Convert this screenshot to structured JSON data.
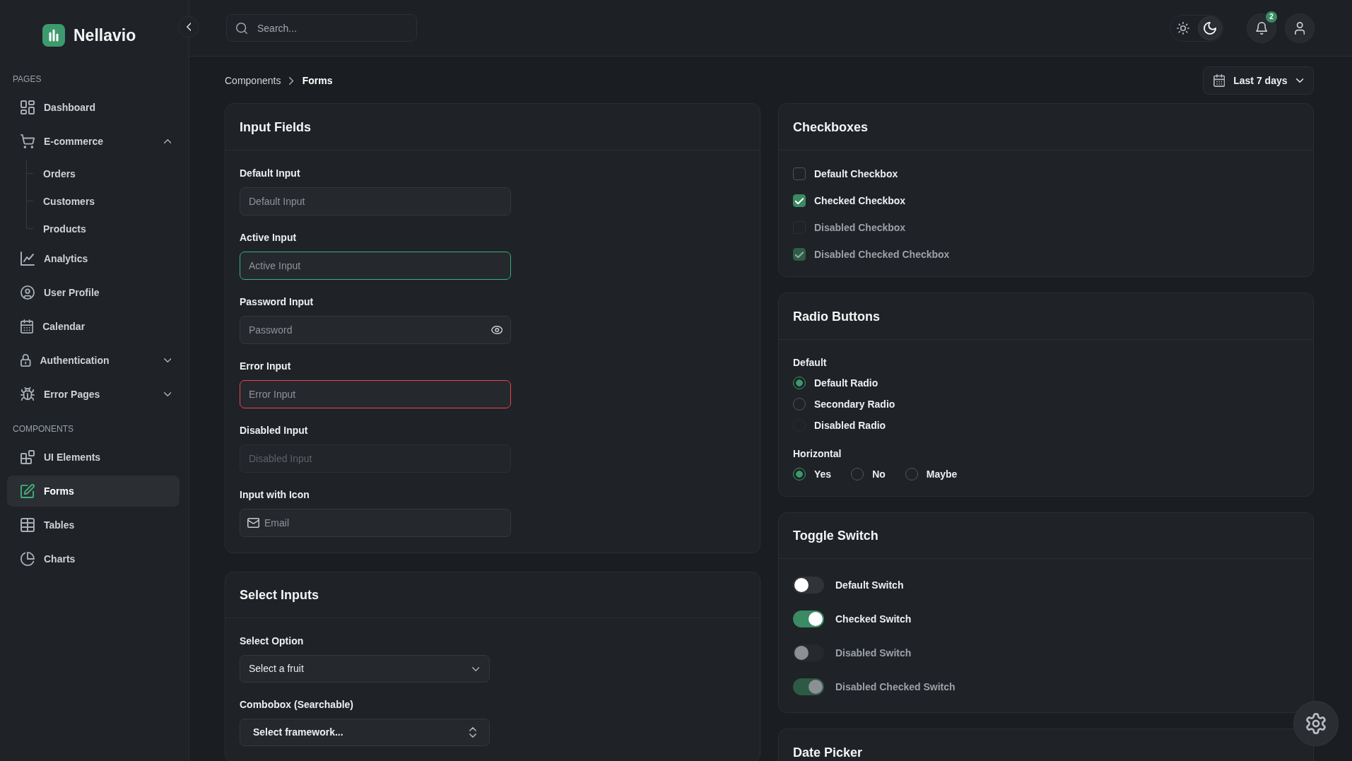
{
  "sidebar": {
    "brand": "Nellavio",
    "sections": [
      {
        "heading": "PAGES",
        "items": [
          {
            "label": "Dashboard",
            "selected": false
          },
          {
            "label": "E-commerce",
            "selected": false,
            "expanded": true,
            "children": [
              {
                "label": "Orders",
                "selected": false
              },
              {
                "label": "Customers",
                "selected": false
              },
              {
                "label": "Products",
                "selected": false
              }
            ]
          },
          {
            "label": "Analytics",
            "selected": false
          },
          {
            "label": "User Profile",
            "selected": false
          },
          {
            "label": "Calendar",
            "selected": false
          },
          {
            "label": "Authentication",
            "selected": false,
            "expanded": false
          },
          {
            "label": "Error Pages",
            "selected": false,
            "expanded": false
          }
        ]
      },
      {
        "heading": "COMPONENTS",
        "items": [
          {
            "label": "UI Elements",
            "selected": false
          },
          {
            "label": "Forms",
            "selected": true
          },
          {
            "label": "Tables",
            "selected": false
          },
          {
            "label": "Charts",
            "selected": false
          }
        ]
      }
    ]
  },
  "topbar": {
    "search": {
      "placeholder": "Search..."
    },
    "theme_options": [
      {
        "selected": false
      },
      {
        "selected": true
      }
    ],
    "notifications": {
      "count": "2"
    }
  },
  "breadcrumb": [
    {
      "label": "Components",
      "current": false
    },
    {
      "label": "Forms",
      "current": true
    }
  ],
  "date_range": {
    "label": "Last 7 days"
  },
  "input_fields": {
    "title": "Input Fields",
    "fields": [
      {
        "label": "Default Input",
        "placeholder": "Default Input",
        "kind": "text",
        "active": false,
        "error": false,
        "disabled": false
      },
      {
        "label": "Active Input",
        "placeholder": "Active Input",
        "kind": "text",
        "active": true,
        "error": false,
        "disabled": false
      },
      {
        "label": "Password Input",
        "placeholder": "Password",
        "kind": "password",
        "active": false,
        "error": false,
        "disabled": false
      },
      {
        "label": "Error Input",
        "placeholder": "Error Input",
        "kind": "text",
        "active": false,
        "error": true,
        "disabled": false
      },
      {
        "label": "Disabled Input",
        "placeholder": "Disabled Input",
        "kind": "text",
        "active": false,
        "error": false,
        "disabled": true
      },
      {
        "label": "Input with Icon",
        "placeholder": "Email",
        "kind": "email",
        "active": false,
        "error": false,
        "disabled": false
      }
    ]
  },
  "select_inputs": {
    "title": "Select Inputs",
    "fields": [
      {
        "label": "Select Option",
        "value": "Select a fruit",
        "kind": "select"
      },
      {
        "label": "Combobox (Searchable)",
        "value": "Select framework...",
        "kind": "combobox"
      }
    ]
  },
  "checkboxes": {
    "title": "Checkboxes",
    "items": [
      {
        "label": "Default Checkbox",
        "checked": false,
        "disabled": false
      },
      {
        "label": "Checked Checkbox",
        "checked": true,
        "disabled": false
      },
      {
        "label": "Disabled Checkbox",
        "checked": false,
        "disabled": true
      },
      {
        "label": "Disabled Checked Checkbox",
        "checked": true,
        "disabled": true
      }
    ]
  },
  "radio_buttons": {
    "title": "Radio Buttons",
    "groups": [
      {
        "label": "Default",
        "kind": "vertical",
        "options": [
          {
            "label": "Default Radio",
            "selected": true,
            "disabled": false
          },
          {
            "label": "Secondary Radio",
            "selected": false,
            "disabled": false
          },
          {
            "label": "Disabled Radio",
            "selected": false,
            "disabled": true
          }
        ]
      },
      {
        "label": "Horizontal",
        "kind": "horizontal",
        "options": [
          {
            "label": "Yes",
            "selected": true,
            "disabled": false
          },
          {
            "label": "No",
            "selected": false,
            "disabled": false
          },
          {
            "label": "Maybe",
            "selected": false,
            "disabled": false
          }
        ]
      }
    ]
  },
  "toggle_switches": {
    "title": "Toggle Switch",
    "items": [
      {
        "label": "Default Switch",
        "on": false,
        "disabled": false
      },
      {
        "label": "Checked Switch",
        "on": true,
        "disabled": false
      },
      {
        "label": "Disabled Switch",
        "on": false,
        "disabled": true
      },
      {
        "label": "Disabled Checked Switch",
        "on": true,
        "disabled": true
      }
    ]
  },
  "date_picker": {
    "title": "Date Picker"
  }
}
